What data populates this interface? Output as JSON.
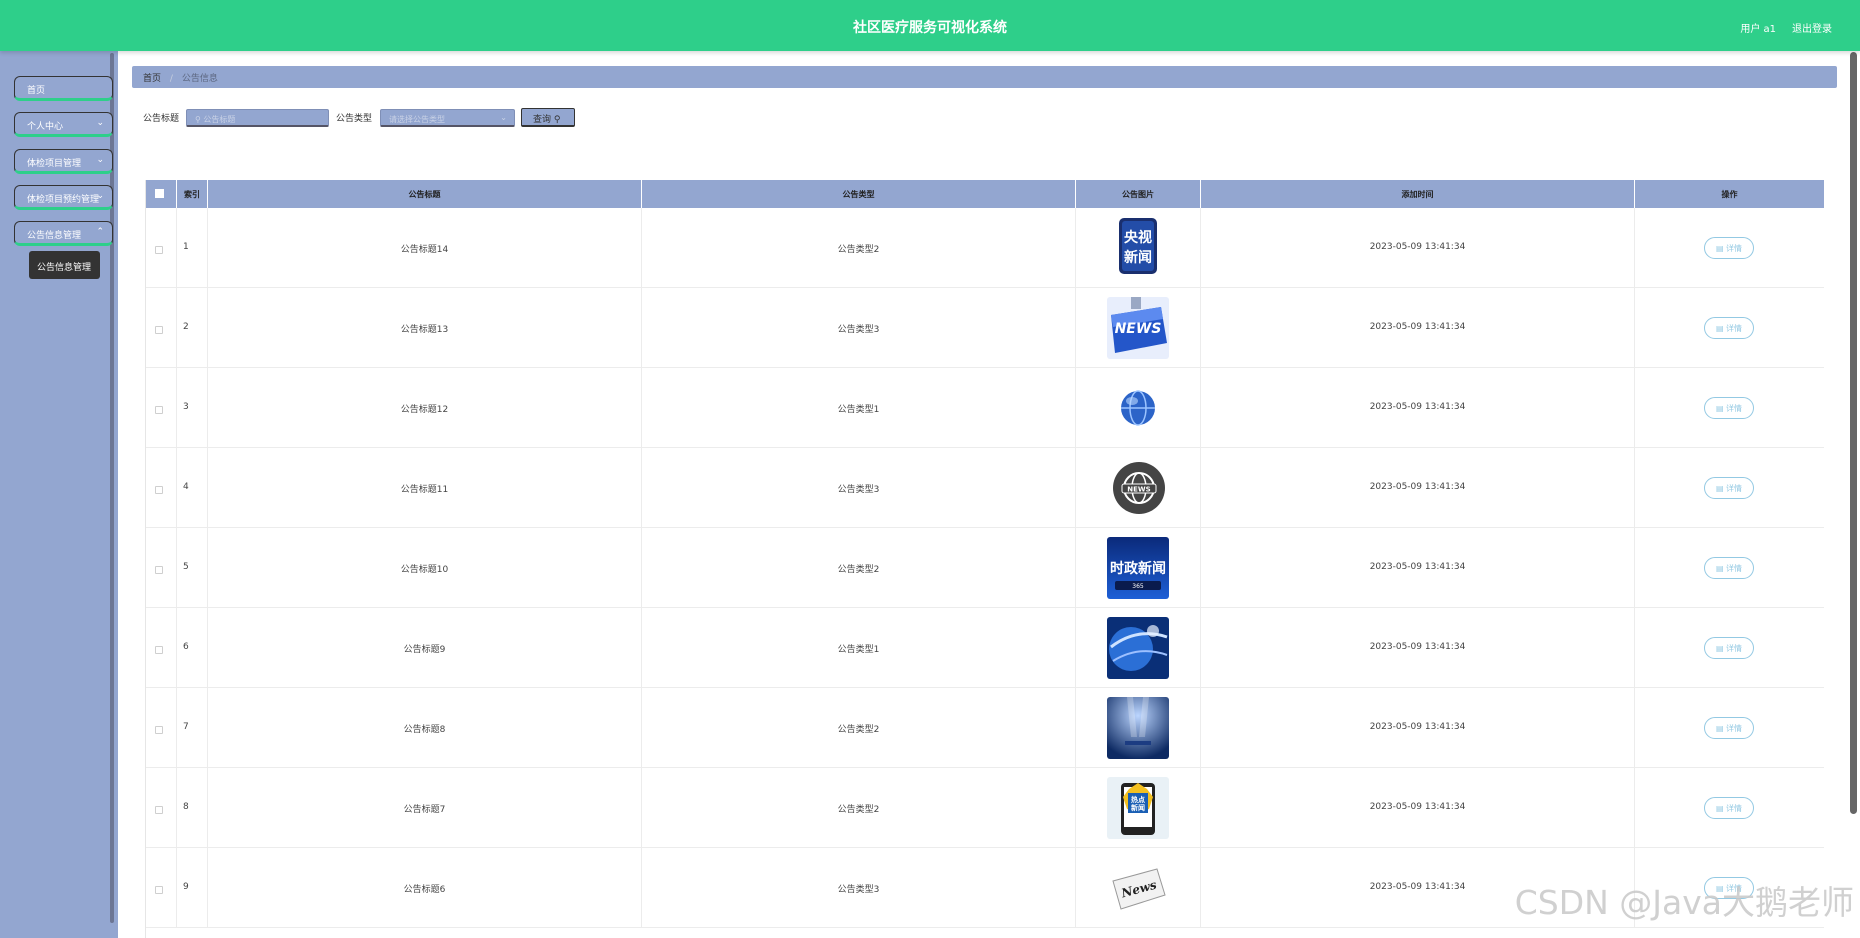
{
  "header": {
    "title": "社区医疗服务可视化系统",
    "user": "用户 a1",
    "logout": "退出登录",
    "bg_color": "#2ecf8a"
  },
  "sidebar": {
    "items": [
      {
        "label": "首页"
      },
      {
        "label": "个人中心"
      },
      {
        "label": "体检项目管理"
      },
      {
        "label": "体检项目预约管理"
      },
      {
        "label": "公告信息管理"
      }
    ],
    "submenu": "公告信息管理",
    "bg_color": "#93a6d0"
  },
  "breadcrumb": {
    "home": "首页",
    "separator": "/",
    "current": "公告信息"
  },
  "search": {
    "title_label": "公告标题",
    "title_placeholder": "公告标题",
    "type_label": "公告类型",
    "type_placeholder": "请选择公告类型",
    "button_label": "查询"
  },
  "table": {
    "columns": [
      "索引",
      "公告标题",
      "公告类型",
      "公告图片",
      "添加时间",
      "操作"
    ],
    "detail_label": "详情",
    "rows": [
      {
        "index": "1",
        "title": "公告标题14",
        "type": "公告类型2",
        "time": "2023-05-09 13:41:34",
        "image": "cctv-news-logo"
      },
      {
        "index": "2",
        "title": "公告标题13",
        "type": "公告类型3",
        "time": "2023-05-09 13:41:34",
        "image": "news-keyboard-key"
      },
      {
        "index": "3",
        "title": "公告标题12",
        "type": "公告类型1",
        "time": "2023-05-09 13:41:34",
        "image": "globe"
      },
      {
        "index": "4",
        "title": "公告标题11",
        "type": "公告类型3",
        "time": "2023-05-09 13:41:34",
        "image": "news-globe-badge"
      },
      {
        "index": "5",
        "title": "公告标题10",
        "type": "公告类型2",
        "time": "2023-05-09 13:41:34",
        "image": "shizheng-news"
      },
      {
        "index": "6",
        "title": "公告标题9",
        "type": "公告类型1",
        "time": "2023-05-09 13:41:34",
        "image": "blue-globe-abstract"
      },
      {
        "index": "7",
        "title": "公告标题8",
        "type": "公告类型2",
        "time": "2023-05-09 13:41:34",
        "image": "news-studio"
      },
      {
        "index": "8",
        "title": "公告标题7",
        "type": "公告类型2",
        "time": "2023-05-09 13:41:34",
        "image": "redian-news-phone"
      },
      {
        "index": "9",
        "title": "公告标题6",
        "type": "公告类型3",
        "time": "2023-05-09 13:41:34",
        "image": "newspaper"
      }
    ]
  },
  "watermark": "CSDN @Java大鹅老师"
}
